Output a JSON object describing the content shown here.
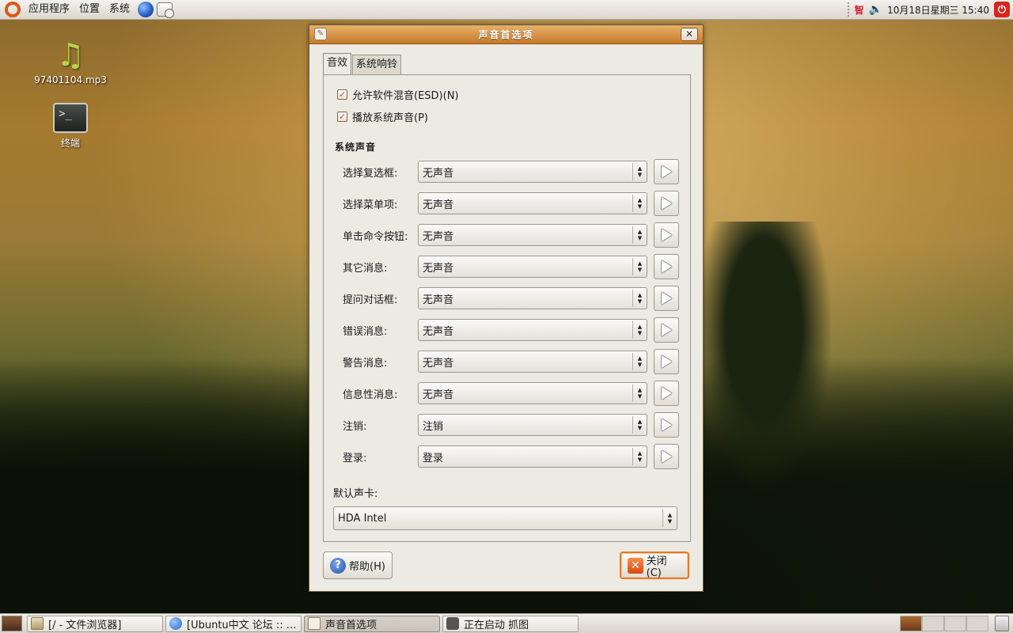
{
  "top_panel": {
    "menus": [
      "应用程序",
      "位置",
      "系统"
    ],
    "ime_label": "智",
    "clock": "10月18日星期三 15:40"
  },
  "desktop": {
    "icons": [
      {
        "label": "97401104.mp3",
        "icon": "music-file-icon"
      },
      {
        "label": "终端",
        "icon": "terminal-icon"
      }
    ]
  },
  "dialog": {
    "title": "声音首选项",
    "tabs": [
      "音效",
      "系统响铃"
    ],
    "active_tab": 0,
    "checkboxes": [
      {
        "label": "允许软件混音(ESD)(N)",
        "checked": true
      },
      {
        "label": "播放系统声音(P)",
        "checked": true
      }
    ],
    "section_title": "系统声音",
    "sounds": [
      {
        "label": "选择复选框:",
        "value": "无声音"
      },
      {
        "label": "选择菜单项:",
        "value": "无声音"
      },
      {
        "label": "单击命令按钮:",
        "value": "无声音"
      },
      {
        "label": "其它消息:",
        "value": "无声音"
      },
      {
        "label": "提问对话框:",
        "value": "无声音"
      },
      {
        "label": "错误消息:",
        "value": "无声音"
      },
      {
        "label": "警告消息:",
        "value": "无声音"
      },
      {
        "label": "信息性消息:",
        "value": "无声音"
      },
      {
        "label": "注销:",
        "value": "注销"
      },
      {
        "label": "登录:",
        "value": "登录"
      }
    ],
    "card_label": "默认声卡:",
    "card_value": "HDA Intel",
    "help_button": "帮助(H)",
    "close_button": "关闭(C)"
  },
  "taskbar": {
    "tasks": [
      {
        "label": "[/ - 文件浏览器]",
        "icon": "folder-icon",
        "active": false
      },
      {
        "label": "[Ubuntu中文 论坛 :: ...",
        "icon": "globe-icon",
        "active": false
      },
      {
        "label": "声音首选项",
        "icon": "dialog-icon",
        "active": true
      },
      {
        "label": "正在启动 抓图",
        "icon": "camera-icon",
        "active": false
      }
    ]
  }
}
